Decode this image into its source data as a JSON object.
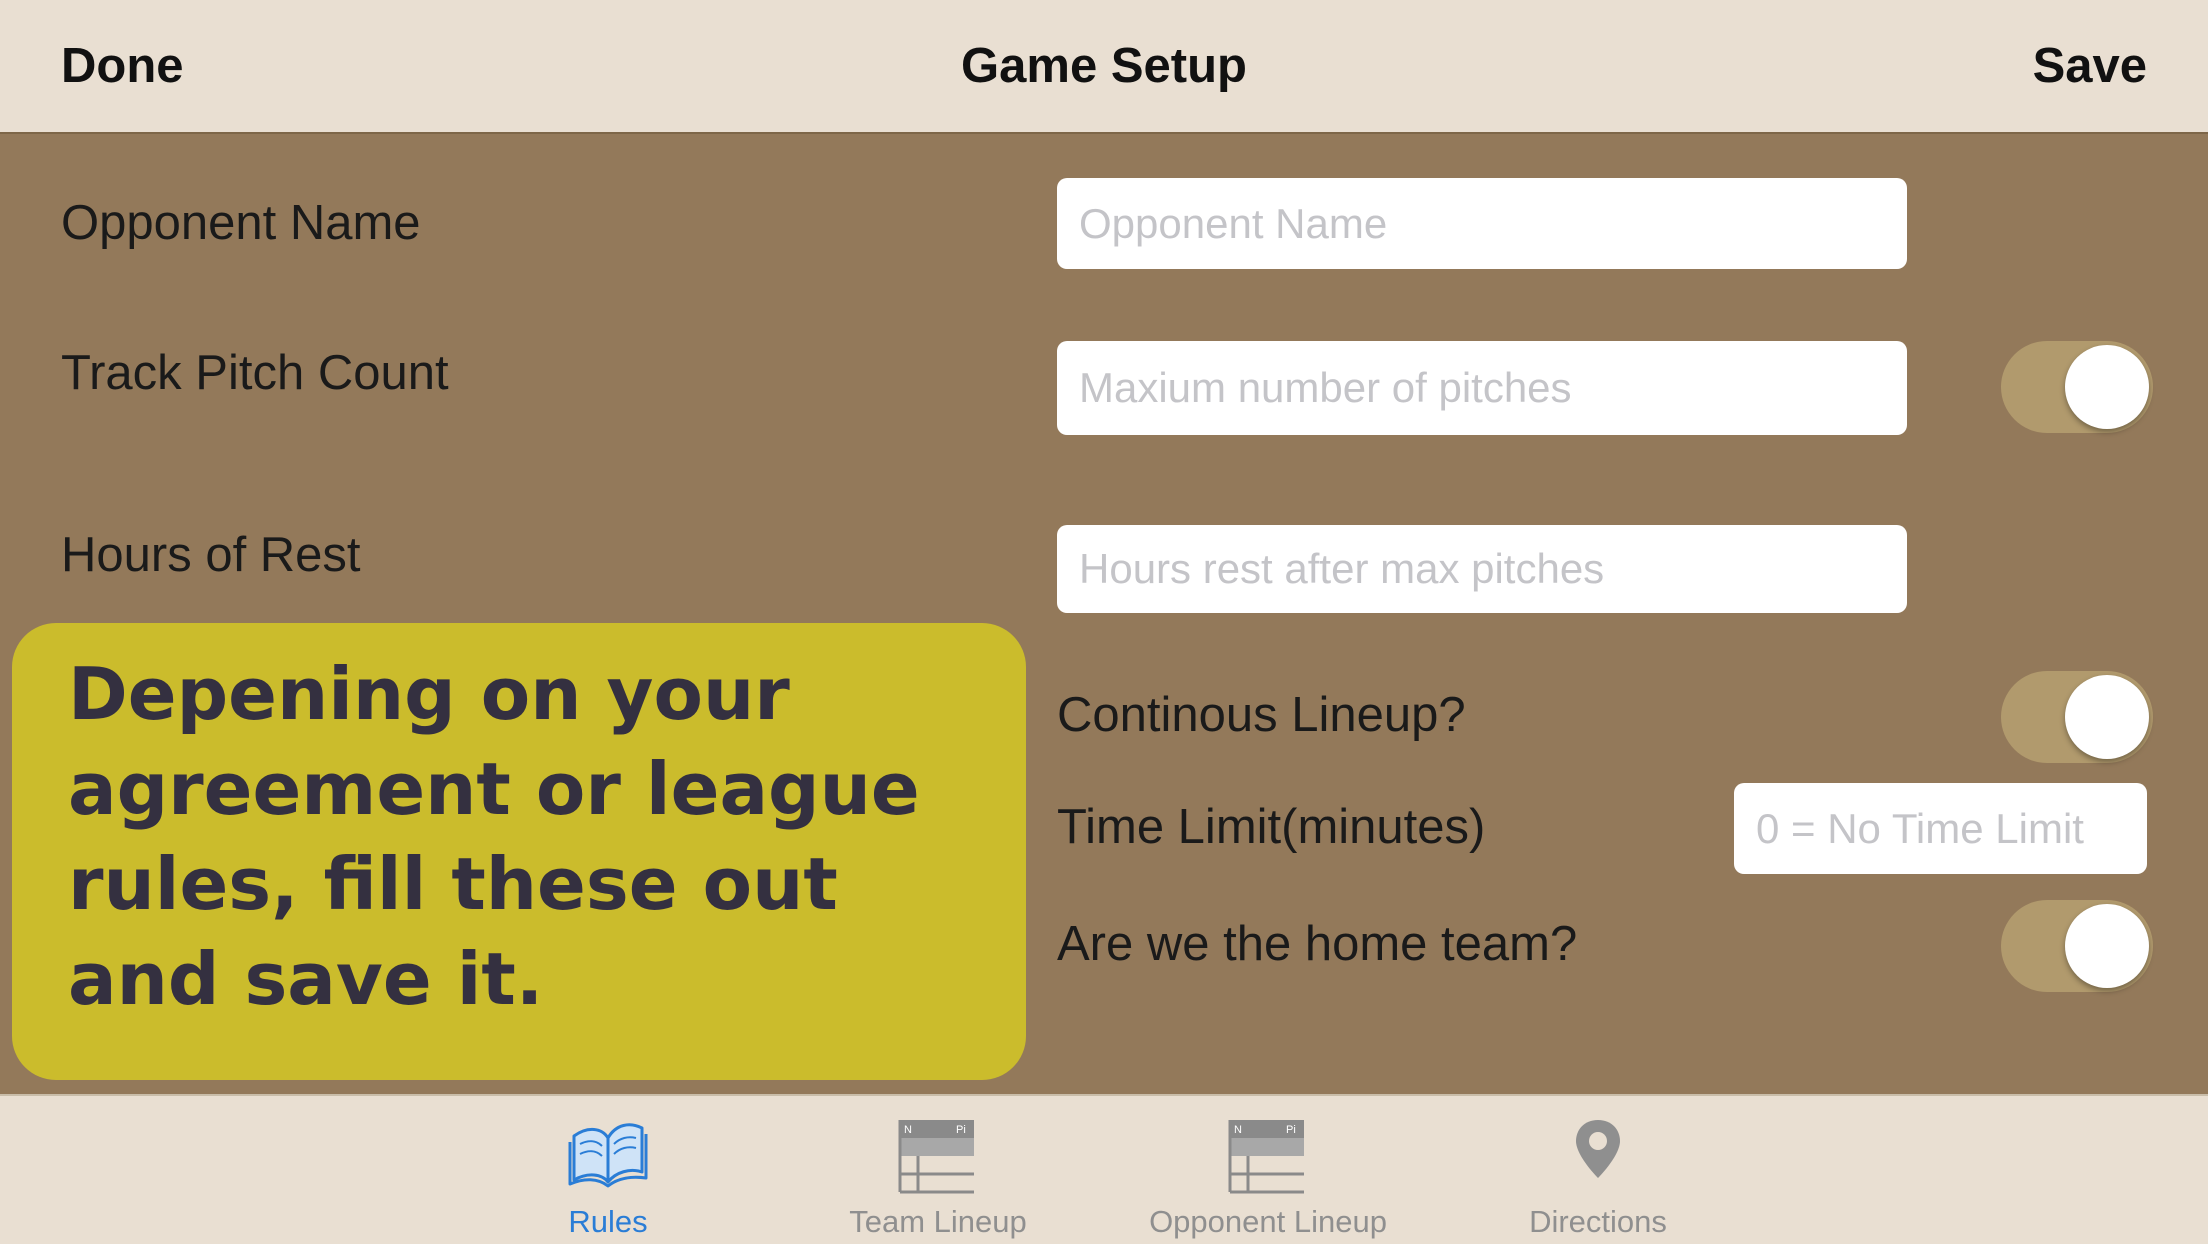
{
  "navbar": {
    "done_label": "Done",
    "title": "Game Setup",
    "save_label": "Save"
  },
  "form": {
    "opponent_name": {
      "label": "Opponent Name",
      "placeholder": "Opponent Name",
      "value": ""
    },
    "track_pitch_count": {
      "label": "Track Pitch Count",
      "placeholder": "Maxium number of pitches",
      "value": "",
      "toggle_on": true
    },
    "hours_of_rest": {
      "label": "Hours of Rest",
      "placeholder": "Hours rest after max pitches",
      "value": ""
    },
    "continuous_lineup": {
      "label": "Continous Lineup?",
      "toggle_on": true
    },
    "time_limit": {
      "label": "Time Limit(minutes)",
      "placeholder": "0 = No Time Limit",
      "value": ""
    },
    "home_team": {
      "label": "Are we the home team?",
      "toggle_on": true
    }
  },
  "callout": {
    "text": "Depening on your agreement or league rules, fill these out and save it."
  },
  "tabs": [
    {
      "label": "Rules",
      "icon": "book-icon",
      "active": true
    },
    {
      "label": "Team Lineup",
      "icon": "lineup-card-icon",
      "active": false
    },
    {
      "label": "Opponent Lineup",
      "icon": "lineup-card-icon",
      "active": false
    },
    {
      "label": "Directions",
      "icon": "map-pin-icon",
      "active": false
    }
  ],
  "colors": {
    "background": "#93795a",
    "bar_background": "#e9dfd2",
    "callout": "#cbbc2c",
    "toggle_track": "#b19a6d",
    "active_tab": "#2a7dd6",
    "inactive_tab": "#8f8f8f"
  }
}
